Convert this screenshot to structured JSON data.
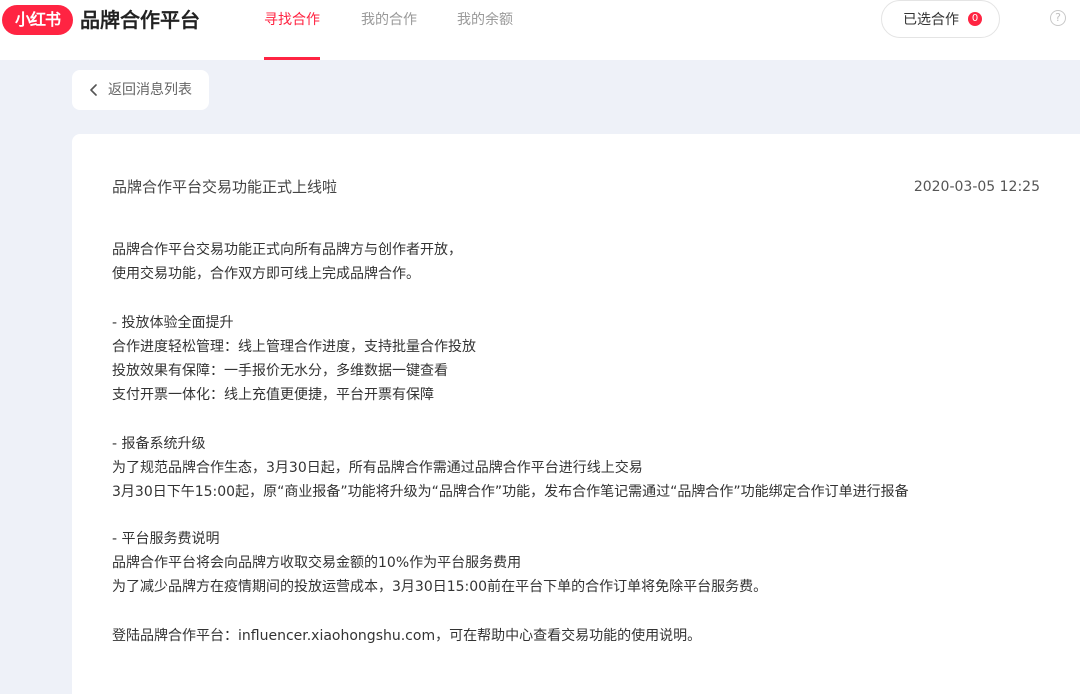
{
  "header": {
    "logo_text": "小红书",
    "brand_title": "品牌合作平台",
    "nav_tabs": [
      {
        "label": "寻找合作",
        "active": true
      },
      {
        "label": "我的合作",
        "active": false
      },
      {
        "label": "我的余额",
        "active": false
      }
    ],
    "selected_label": "已选合作",
    "selected_count": "0",
    "help_glyph": "?",
    "accent_color": "#ff2442"
  },
  "back": {
    "label": "返回消息列表",
    "icon": "chevron-left-icon"
  },
  "message": {
    "title": "品牌合作平台交易功能正式上线啦",
    "time": "2020-03-05 12:25",
    "lines": [
      "品牌合作平台交易功能正式向所有品牌方与创作者开放，",
      "使用交易功能，合作双方即可线上完成品牌合作。",
      "- 投放体验全面提升",
      "合作进度轻松管理：线上管理合作进度，支持批量合作投放",
      "投放效果有保障：一手报价无水分，多维数据一键查看",
      "支付开票一体化：线上充值更便捷，平台开票有保障",
      "- 报备系统升级",
      "为了规范品牌合作生态，3月30日起，所有品牌合作需通过品牌合作平台进行线上交易",
      "3月30日下午15:00起，原“商业报备”功能将升级为“品牌合作”功能，发布合作笔记需通过“品牌合作”功能绑定合作订单进行报备",
      "- 平台服务费说明",
      "品牌合作平台将会向品牌方收取交易金额的10%作为平台服务费用",
      "为了减少品牌方在疫情期间的投放运营成本，3月30日15:00前在平台下单的合作订单将免除平台服务费。",
      "登陆品牌合作平台：influencer.xiaohongshu.com，可在帮助中心查看交易功能的使用说明。"
    ]
  }
}
